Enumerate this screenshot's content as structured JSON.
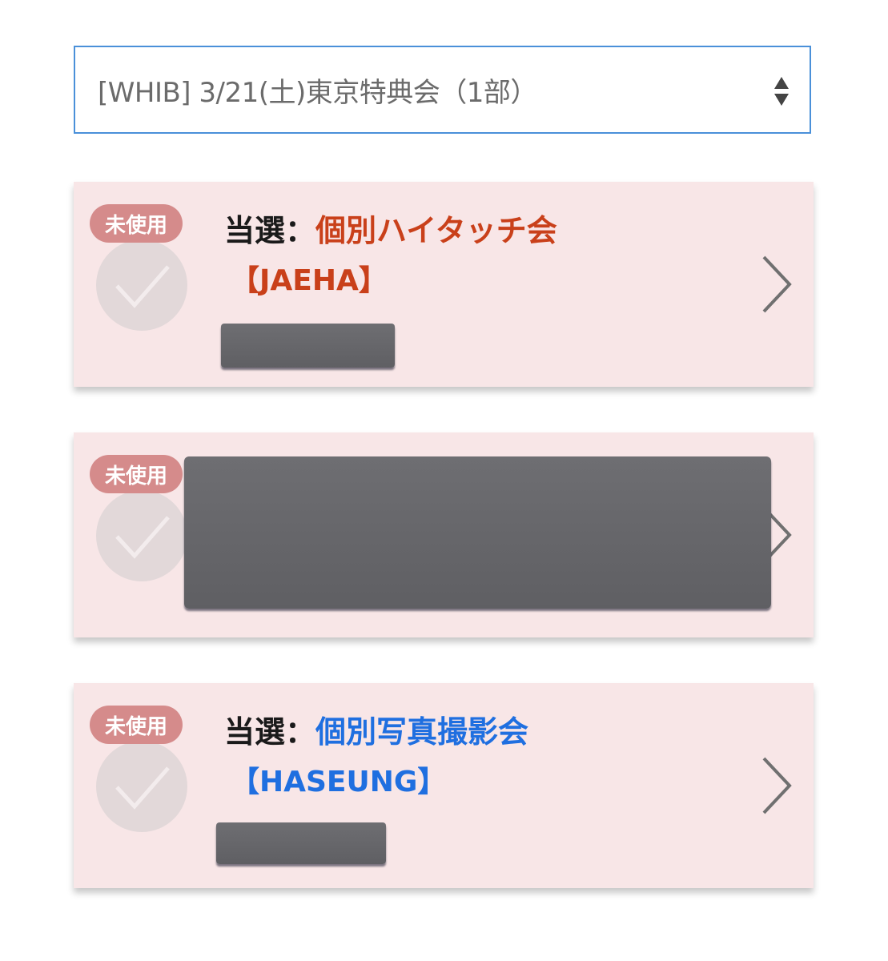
{
  "event_select": {
    "value": "[WHIB] 3/21(土)東京特典会（1部）",
    "icon": "up-down-arrows-icon"
  },
  "tickets": [
    {
      "status_badge": "未使用",
      "title_prefix": "当選：",
      "ticket_type": "個別ハイタッチ会",
      "member": "【JAEHA】",
      "type_color": "#c9401a"
    },
    {
      "status_badge": "未使用"
    },
    {
      "status_badge": "未使用",
      "title_prefix": "当選：",
      "ticket_type": "個別写真撮影会",
      "member": "【HASEUNG】",
      "type_color": "#1f6fe0"
    }
  ],
  "colors": {
    "card_background": "#f8e6e7",
    "badge_background": "#d58b8b",
    "select_border": "#4a90d9",
    "redaction": "#666669"
  }
}
